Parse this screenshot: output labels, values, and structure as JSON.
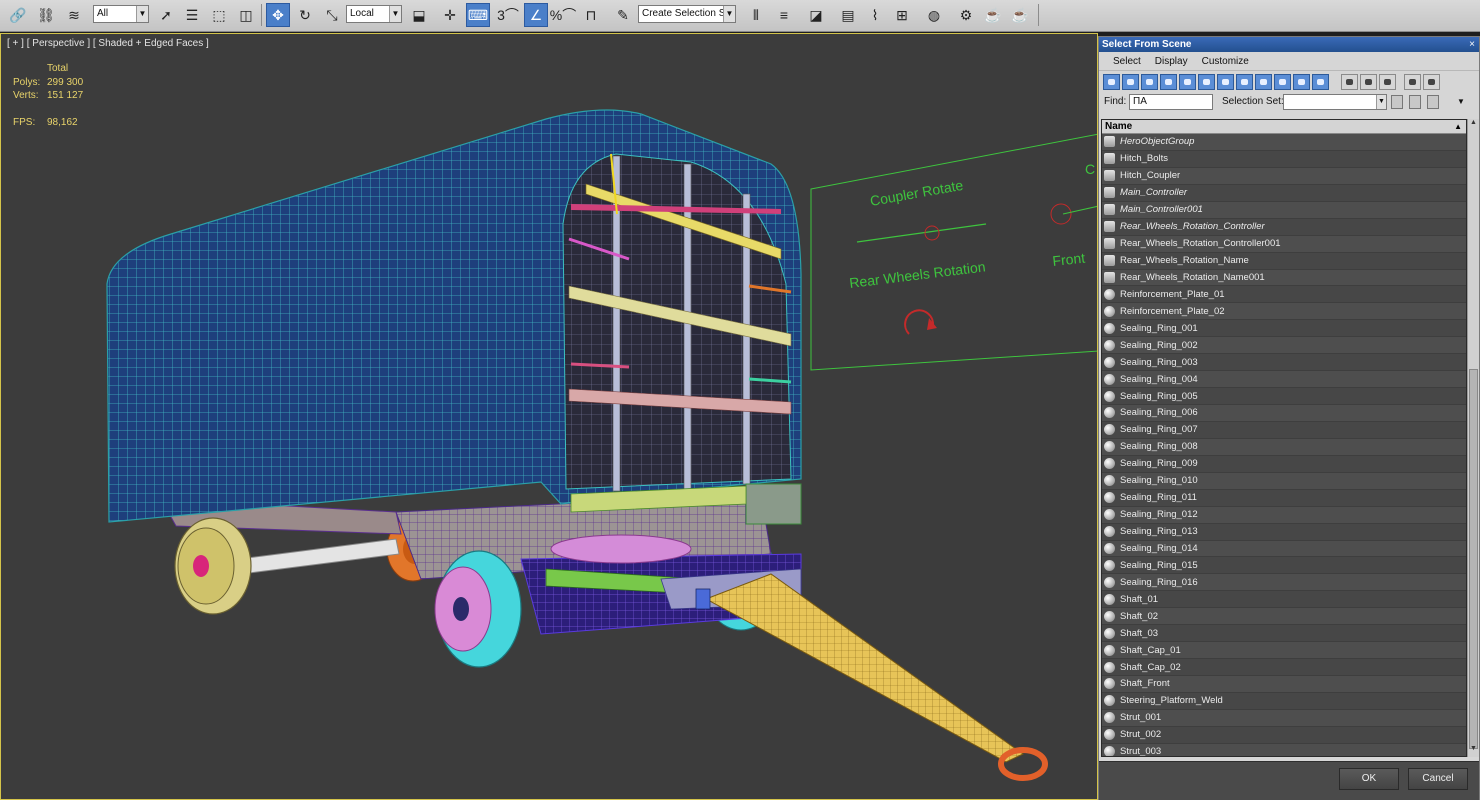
{
  "toolbar": {
    "filter_value": "All",
    "coord_system_value": "Local",
    "selection_set_placeholder": "Create Selection Se",
    "snap_angle_label": "3",
    "percent_label": "%"
  },
  "viewport": {
    "label": "[ + ] [ Perspective ] [ Shaded + Edged Faces ]",
    "stats": {
      "total_label": "Total",
      "polys_label": "Polys:",
      "polys_value": "299 300",
      "verts_label": "Verts:",
      "verts_value": "151 127",
      "fps_label": "FPS:",
      "fps_value": "98,162"
    },
    "controller_text": {
      "coupler_rotate": "Coupler Rotate",
      "rear_wheels_rotation": "Rear Wheels Rotation",
      "front": "Front",
      "c": "C"
    }
  },
  "dialog": {
    "title": "Select From Scene",
    "close": "×",
    "menu": [
      "Select",
      "Display",
      "Customize"
    ],
    "find_label": "Find:",
    "find_value": "ПА",
    "selection_set_label": "Selection Set:",
    "column_name": "Name",
    "items": [
      {
        "name": "HeroObjectGroup",
        "italic": true,
        "icon": "helper"
      },
      {
        "name": "Hitch_Bolts",
        "italic": false,
        "icon": "helper"
      },
      {
        "name": "Hitch_Coupler",
        "italic": false,
        "icon": "helper"
      },
      {
        "name": "Main_Controller",
        "italic": true,
        "icon": "helper"
      },
      {
        "name": "Main_Controller001",
        "italic": true,
        "icon": "helper"
      },
      {
        "name": "Rear_Wheels_Rotation_Controller",
        "italic": true,
        "icon": "helper"
      },
      {
        "name": "Rear_Wheels_Rotation_Controller001",
        "italic": false,
        "icon": "helper"
      },
      {
        "name": "Rear_Wheels_Rotation_Name",
        "italic": false,
        "icon": "helper"
      },
      {
        "name": "Rear_Wheels_Rotation_Name001",
        "italic": false,
        "icon": "helper"
      },
      {
        "name": "Reinforcement_Plate_01",
        "italic": false,
        "icon": "geometry"
      },
      {
        "name": "Reinforcement_Plate_02",
        "italic": false,
        "icon": "geometry"
      },
      {
        "name": "Sealing_Ring_001",
        "italic": false,
        "icon": "geometry"
      },
      {
        "name": "Sealing_Ring_002",
        "italic": false,
        "icon": "geometry"
      },
      {
        "name": "Sealing_Ring_003",
        "italic": false,
        "icon": "geometry"
      },
      {
        "name": "Sealing_Ring_004",
        "italic": false,
        "icon": "geometry"
      },
      {
        "name": "Sealing_Ring_005",
        "italic": false,
        "icon": "geometry"
      },
      {
        "name": "Sealing_Ring_006",
        "italic": false,
        "icon": "geometry"
      },
      {
        "name": "Sealing_Ring_007",
        "italic": false,
        "icon": "geometry"
      },
      {
        "name": "Sealing_Ring_008",
        "italic": false,
        "icon": "geometry"
      },
      {
        "name": "Sealing_Ring_009",
        "italic": false,
        "icon": "geometry"
      },
      {
        "name": "Sealing_Ring_010",
        "italic": false,
        "icon": "geometry"
      },
      {
        "name": "Sealing_Ring_011",
        "italic": false,
        "icon": "geometry"
      },
      {
        "name": "Sealing_Ring_012",
        "italic": false,
        "icon": "geometry"
      },
      {
        "name": "Sealing_Ring_013",
        "italic": false,
        "icon": "geometry"
      },
      {
        "name": "Sealing_Ring_014",
        "italic": false,
        "icon": "geometry"
      },
      {
        "name": "Sealing_Ring_015",
        "italic": false,
        "icon": "geometry"
      },
      {
        "name": "Sealing_Ring_016",
        "italic": false,
        "icon": "geometry"
      },
      {
        "name": "Shaft_01",
        "italic": false,
        "icon": "geometry"
      },
      {
        "name": "Shaft_02",
        "italic": false,
        "icon": "geometry"
      },
      {
        "name": "Shaft_03",
        "italic": false,
        "icon": "geometry"
      },
      {
        "name": "Shaft_Cap_01",
        "italic": false,
        "icon": "geometry"
      },
      {
        "name": "Shaft_Cap_02",
        "italic": false,
        "icon": "geometry"
      },
      {
        "name": "Shaft_Front",
        "italic": false,
        "icon": "geometry"
      },
      {
        "name": "Steering_Platform_Weld",
        "italic": false,
        "icon": "geometry"
      },
      {
        "name": "Strut_001",
        "italic": false,
        "icon": "geometry"
      },
      {
        "name": "Strut_002",
        "italic": false,
        "icon": "geometry"
      },
      {
        "name": "Strut_003",
        "italic": false,
        "icon": "geometry"
      }
    ],
    "ok_label": "OK",
    "cancel_label": "Cancel"
  },
  "colors": {
    "viewport_bg": "#3c3c3c",
    "viewport_border": "#d4c44a",
    "stats_text": "#e8d36a",
    "controller_green": "#3ec43e",
    "tarp_blue": "#1c3f7a",
    "tarp_wire": "#3cc0c0",
    "active_button": "#4a7fc9",
    "dialog_title": "#2c5aa0"
  }
}
